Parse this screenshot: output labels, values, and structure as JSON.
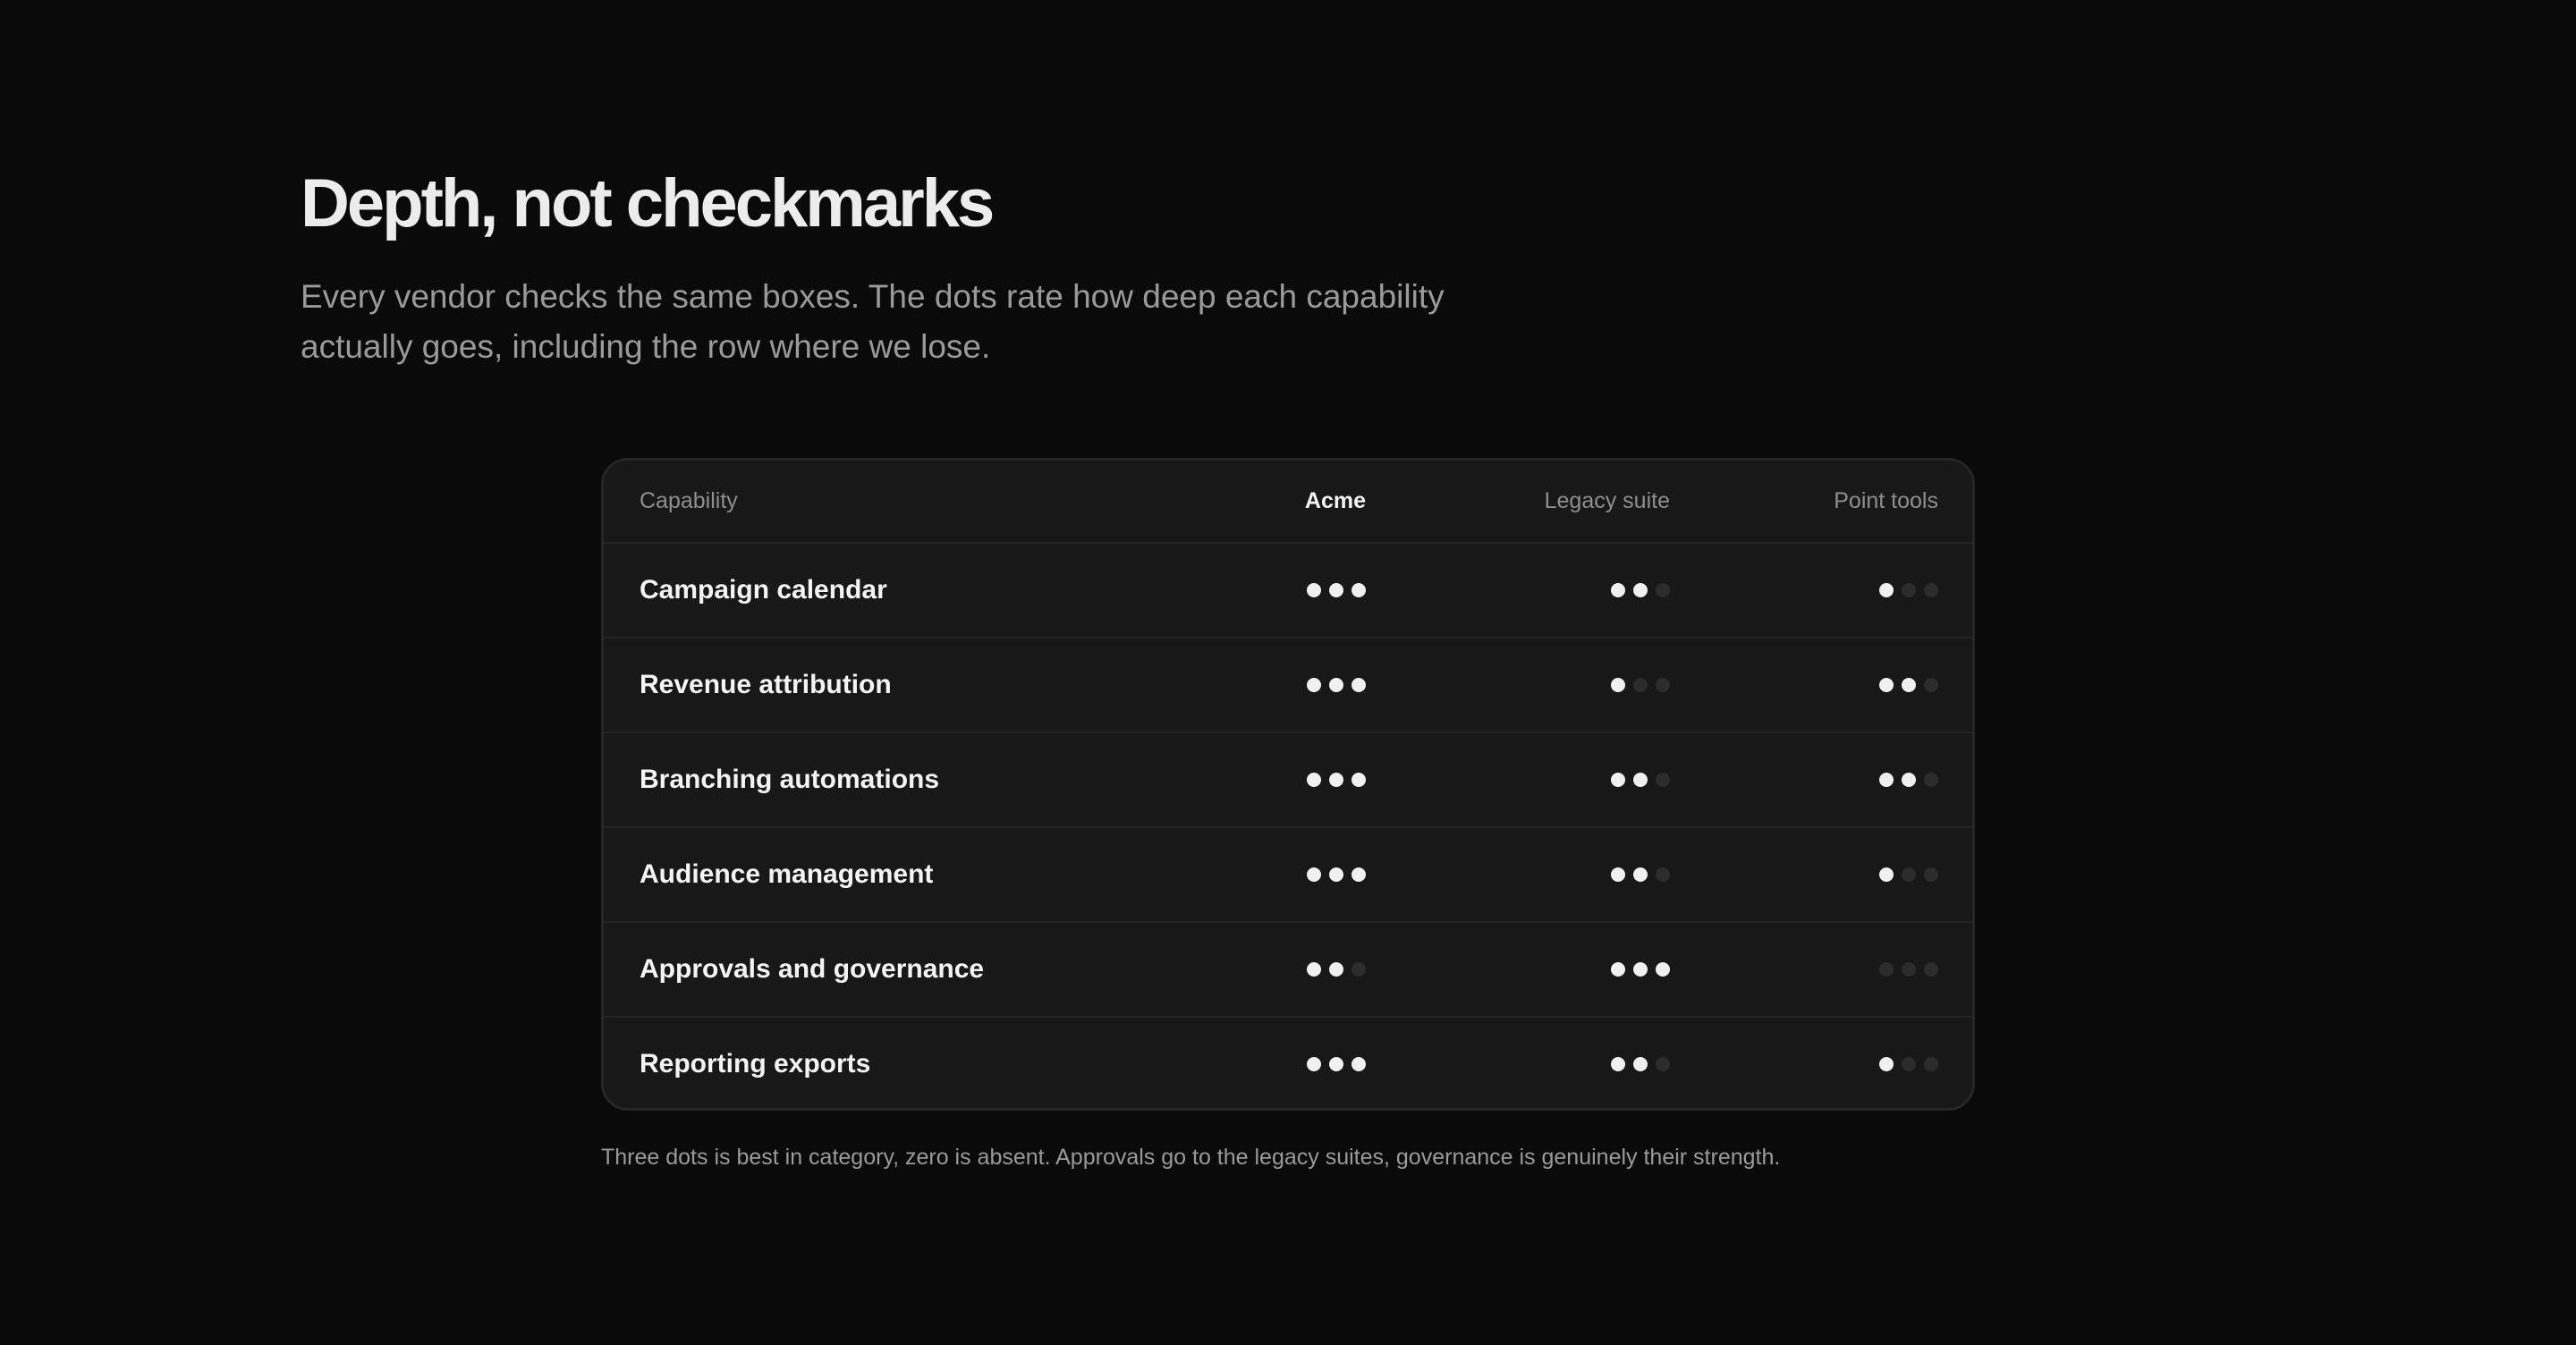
{
  "heading": "Depth, not checkmarks",
  "subhead": "Every vendor checks the same boxes. The dots rate how deep each capability actually goes, including the row where we lose.",
  "table": {
    "columns": {
      "capability": "Capability",
      "acme": "Acme",
      "legacy": "Legacy suite",
      "point": "Point tools"
    },
    "max_dots": 3,
    "rows": [
      {
        "capability": "Campaign calendar",
        "acme": 3,
        "legacy": 2,
        "point": 1
      },
      {
        "capability": "Revenue attribution",
        "acme": 3,
        "legacy": 1,
        "point": 2
      },
      {
        "capability": "Branching automations",
        "acme": 3,
        "legacy": 2,
        "point": 2
      },
      {
        "capability": "Audience management",
        "acme": 3,
        "legacy": 2,
        "point": 1
      },
      {
        "capability": "Approvals and governance",
        "acme": 2,
        "legacy": 3,
        "point": 0
      },
      {
        "capability": "Reporting exports",
        "acme": 3,
        "legacy": 2,
        "point": 1
      }
    ]
  },
  "footnote": "Three dots is best in category, zero is absent. Approvals go to the legacy suites, governance is genuinely their strength.",
  "colors": {
    "background": "#0a0a0a",
    "card": "#181818",
    "dot_on": "#f0f0f0",
    "dot_off": "#2c2c2c"
  }
}
